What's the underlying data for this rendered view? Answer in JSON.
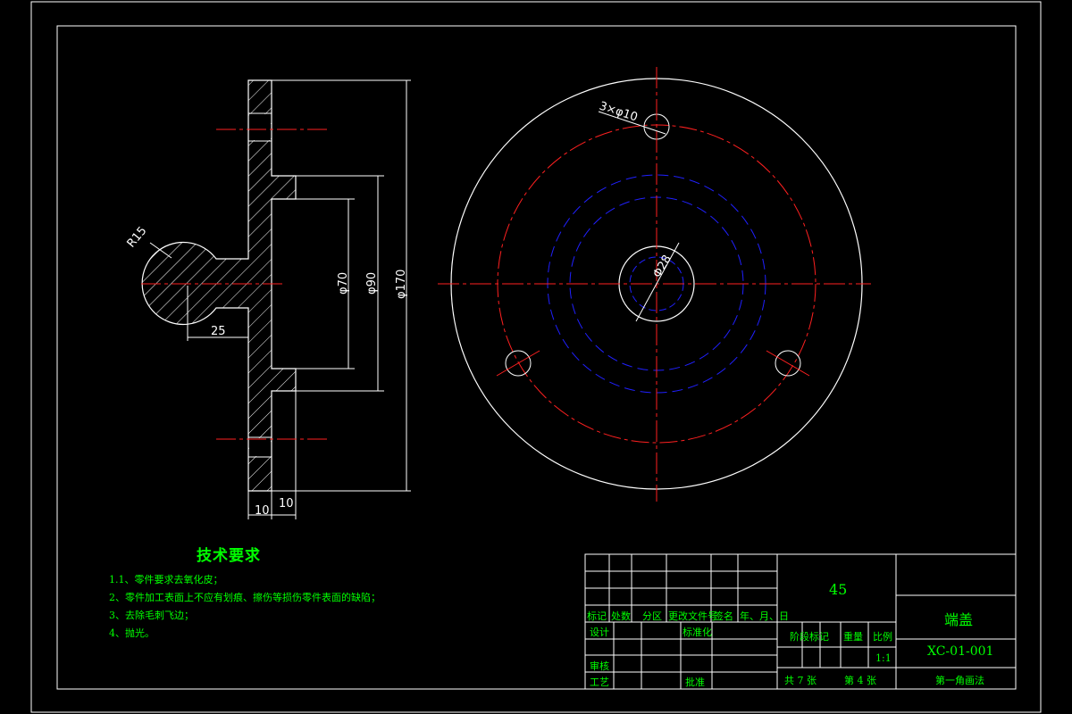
{
  "dimensions": {
    "r15": "R15",
    "len25": "25",
    "d70": "φ70",
    "d90": "φ90",
    "d170": "φ170",
    "t10a": "10",
    "t10b": "10",
    "holes": "3×φ10",
    "d28": "Φ28"
  },
  "notes": {
    "title": "技术要求",
    "items": [
      "1.1、零件要求去氧化皮；",
      "2、零件加工表面上不应有划痕、擦伤等损伤零件表面的缺陷；",
      "3、去除毛刺飞边；",
      "4、抛光。"
    ]
  },
  "title_block": {
    "material": "45",
    "part_name": "端盖",
    "drawing_no": "XC-01-001",
    "projection": "第一角画法",
    "headers": [
      "标记",
      "处数",
      "分区",
      "更改文件号",
      "签名",
      "年、月、日"
    ],
    "design": "设计",
    "standardization": "标准化",
    "review": "审核",
    "process": "工艺",
    "approve": "批准",
    "stage_mark": "阶段标记",
    "weight": "重量",
    "scale_label": "比例",
    "scale": "1:1",
    "sheets_total": "共  7  张",
    "sheet_no": "第  4  张"
  },
  "colors": {
    "outline": "#ffffff",
    "centerline": "#ff2020",
    "hidden": "#2020ff",
    "text": "#00ff00"
  }
}
